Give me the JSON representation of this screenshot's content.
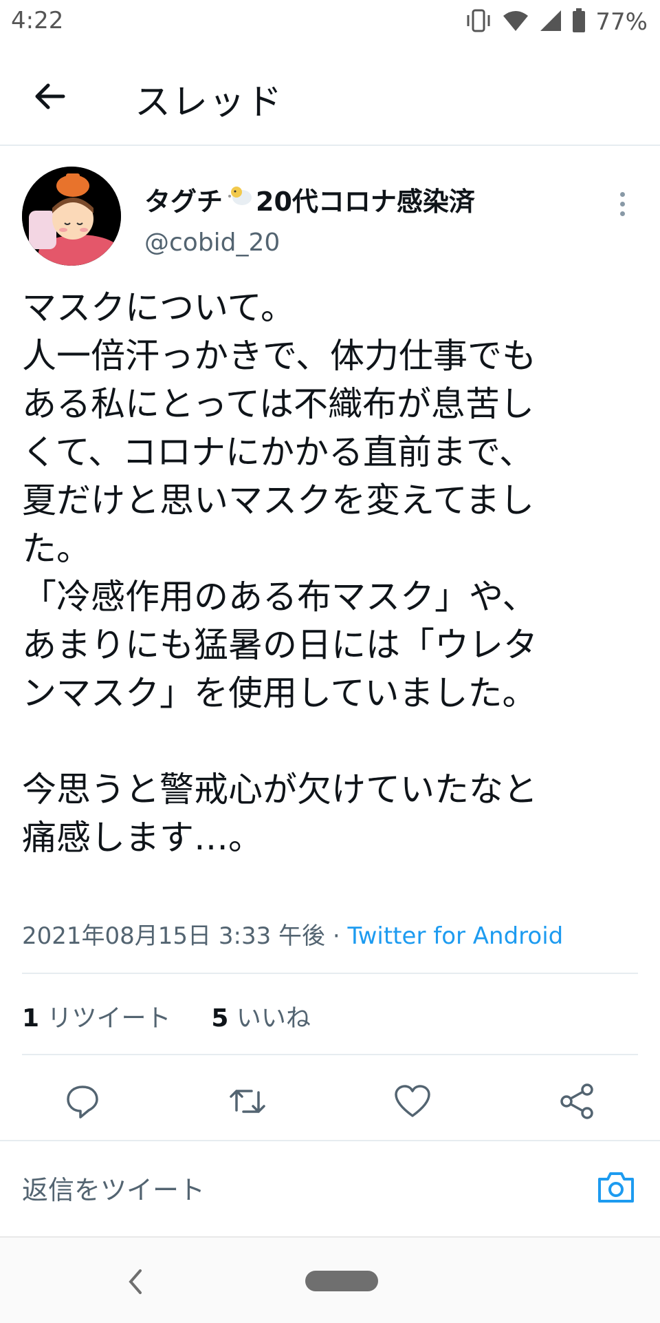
{
  "status_bar": {
    "time": "4:22",
    "battery_percent": "77%",
    "icons": [
      "vibrate-icon",
      "wifi-icon",
      "signal-icon",
      "battery-icon"
    ]
  },
  "header": {
    "back_icon": "back-arrow-icon",
    "title": "スレッド"
  },
  "tweet": {
    "display_name": "タグチ",
    "display_name_suffix": "20代コロナ感染済",
    "display_name_emoji": "sheep-emoji-icon",
    "handle": "@cobid_20",
    "more_icon": "more-vertical-icon",
    "body": "マスクについて。\n人一倍汗っかきで、体力仕事でも\nある私にとっては不織布が息苦し\nくて、コロナにかかる直前まで、\n夏だけと思いマスクを変えてまし\nた。\n「冷感作用のある布マスク」や、\nあまりにも猛暑の日には「ウレタ\nンマスク」を使用していました。\n\n今思うと警戒心が欠けていたなと\n痛感します…。",
    "timestamp": "2021年08月15日 3:33 午後",
    "separator": " · ",
    "source": "Twitter for Android",
    "retweet_count": "1",
    "retweet_label": " リツイート",
    "like_count": "5",
    "like_label": " いいね"
  },
  "actions": {
    "reply_icon": "reply-icon",
    "retweet_icon": "retweet-icon",
    "like_icon": "heart-icon",
    "share_icon": "share-icon"
  },
  "reply_bar": {
    "placeholder": "返信をツイート",
    "camera_icon": "camera-icon"
  },
  "colors": {
    "accent": "#1d9bf0",
    "text": "#0f1419",
    "secondary": "#536471",
    "divider": "#e6ecf0"
  }
}
